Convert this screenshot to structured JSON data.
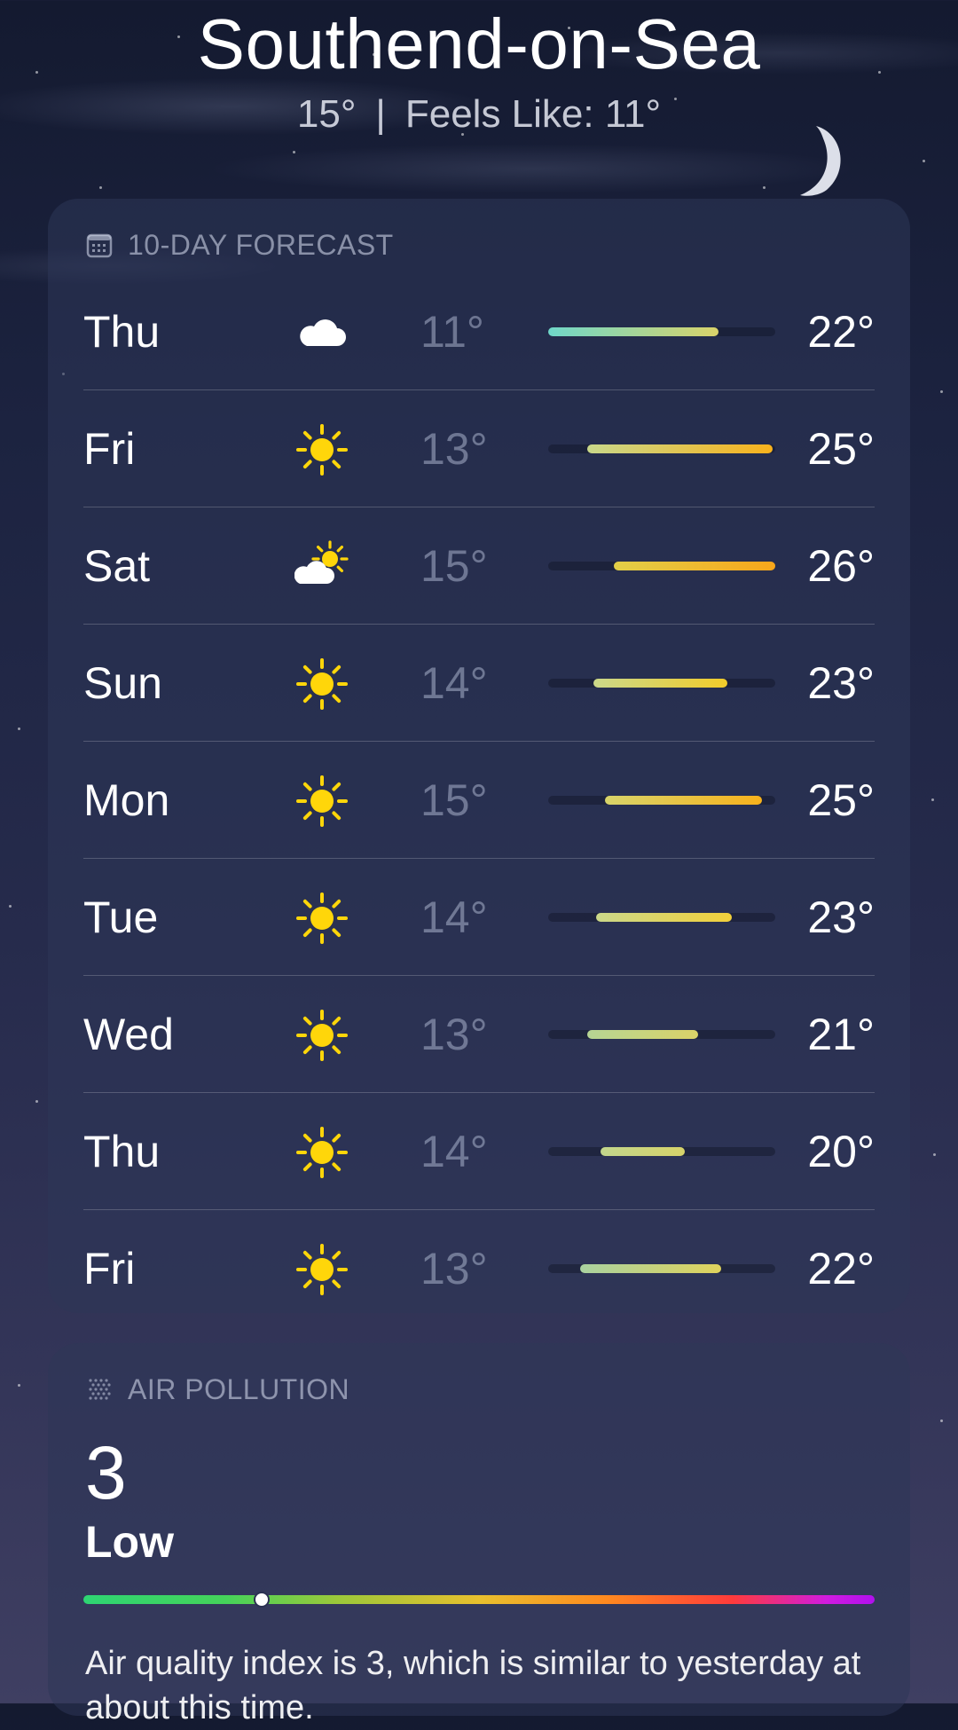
{
  "header": {
    "city": "Southend-on-Sea",
    "current_temp": "15°",
    "separator": "|",
    "feels_like": "Feels Like: 11°"
  },
  "forecast": {
    "title": "10-DAY FORECAST",
    "rows": [
      {
        "day": "Thu",
        "icon": "cloud-icon",
        "low": "11°",
        "high": "22°",
        "bar": [
          0.0,
          0.75
        ],
        "grad": [
          "#6fd7c9",
          "#d9d36a"
        ]
      },
      {
        "day": "Fri",
        "icon": "sun-icon",
        "low": "13°",
        "high": "25°",
        "bar": [
          0.17,
          0.99
        ],
        "grad": [
          "#c9d88a",
          "#f8b21c"
        ]
      },
      {
        "day": "Sat",
        "icon": "partly-sunny-icon",
        "low": "15°",
        "high": "26°",
        "bar": [
          0.29,
          1.0
        ],
        "grad": [
          "#e2cf48",
          "#f8a61a"
        ]
      },
      {
        "day": "Sun",
        "icon": "sun-icon",
        "low": "14°",
        "high": "23°",
        "bar": [
          0.2,
          0.79
        ],
        "grad": [
          "#cbd88a",
          "#f2cc2a"
        ]
      },
      {
        "day": "Mon",
        "icon": "sun-icon",
        "low": "15°",
        "high": "25°",
        "bar": [
          0.25,
          0.94
        ],
        "grad": [
          "#d8d46a",
          "#f8b21c"
        ]
      },
      {
        "day": "Tue",
        "icon": "sun-icon",
        "low": "14°",
        "high": "23°",
        "bar": [
          0.21,
          0.81
        ],
        "grad": [
          "#cbd88a",
          "#f2d03a"
        ]
      },
      {
        "day": "Wed",
        "icon": "sun-icon",
        "low": "13°",
        "high": "21°",
        "bar": [
          0.17,
          0.66
        ],
        "grad": [
          "#b6d494",
          "#dad368"
        ]
      },
      {
        "day": "Thu",
        "icon": "sun-icon",
        "low": "14°",
        "high": "20°",
        "bar": [
          0.23,
          0.6
        ],
        "grad": [
          "#c2d68c",
          "#d7d36a"
        ]
      },
      {
        "day": "Fri",
        "icon": "sun-icon",
        "low": "13°",
        "high": "22°",
        "bar": [
          0.14,
          0.76
        ],
        "grad": [
          "#a9d2a0",
          "#e0d35c"
        ]
      }
    ]
  },
  "air": {
    "title": "AIR POLLUTION",
    "value": "3",
    "label": "Low",
    "marker_fraction": 0.225,
    "description": "Air quality index is 3, which is similar to yesterday at about this time."
  },
  "colors": {
    "sun": "#ffd60a",
    "cloud": "#ffffff"
  }
}
